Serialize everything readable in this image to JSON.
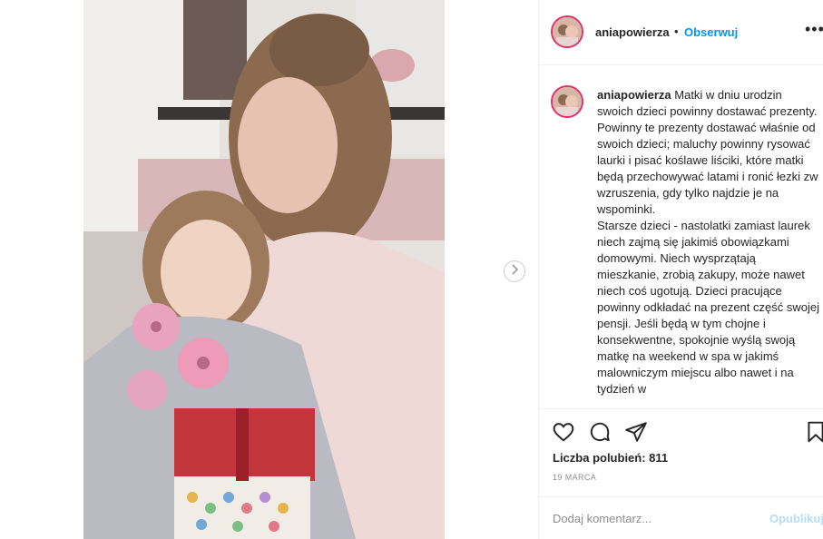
{
  "post": {
    "username": "aniapowierza",
    "separator": "•",
    "follow_label": "Obserwuj",
    "more_label": "•••",
    "caption_text": "Matki w dniu urodzin swoich dzieci powinny dostawać prezenty.\nPowinny te prezenty dostawać właśnie od swoich dzieci; maluchy powinny rysować laurki i pisać koślawe liściki, które matki będą przechowywać latami i ronić łezki zw wzruszenia, gdy tylko najdzie je na wspominki.\nStarsze dzieci - nastolatki zamiast laurek niech zajmą się jakimiś obowiązkami domowymi. Niech wysprzątają mieszkanie, zrobią zakupy, może nawet niech coś ugotują. Dzieci pracujące powinny odkładać na prezent część swojej pensji. Jeśli będą w tym chojne i konsekwentne, spokojnie wyślą swoją matkę na weekend w spa w jakimś malowniczym miejscu albo nawet i na tydzień w",
    "likes_text": "Liczba polubień: 811",
    "date_text": "19 MARCA",
    "comment_placeholder": "Dodaj komentarz...",
    "publish_label": "Opublikuj"
  },
  "icons": {
    "next": "chevron-right-icon",
    "like": "heart-icon",
    "comment": "comment-icon",
    "share": "paper-plane-icon",
    "save": "bookmark-icon"
  },
  "colors": {
    "follow": "#0095f6",
    "publish_disabled": "#b2dffc",
    "avatar_ring": "#e1306c"
  }
}
